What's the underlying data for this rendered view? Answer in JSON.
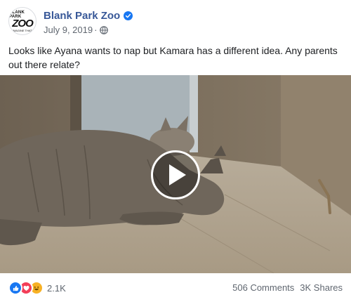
{
  "post": {
    "page_name": "Blank Park Zoo",
    "date": "July 9, 2019",
    "separator": "·",
    "text": "Looks like Ayana wants to nap but Kamara has a different idea. Any parents out there relate?"
  },
  "avatar": {
    "line1": "BLANK PARK",
    "line2": "ZOO",
    "line3": "IMAGINE THAT."
  },
  "icons": {
    "verified": "verified-badge-icon",
    "audience": "globe-icon",
    "play": "play-icon",
    "reactions": [
      "like-icon",
      "love-icon",
      "haha-icon"
    ]
  },
  "footer": {
    "reaction_count": "2.1K",
    "comments": "506 Comments",
    "shares": "3K Shares"
  },
  "colors": {
    "page_name": "#385898",
    "secondary_text": "#606770",
    "like": "#1877f2",
    "love": "#f33e58",
    "haha": "#f7b125"
  }
}
